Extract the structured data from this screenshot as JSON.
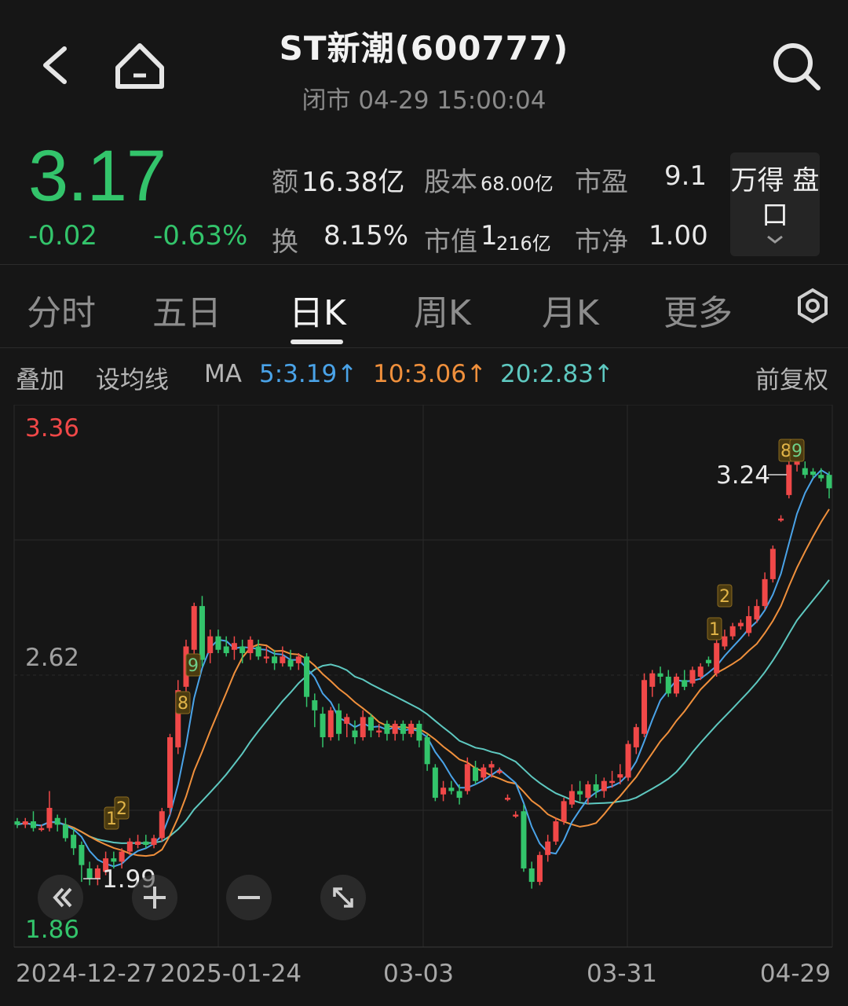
{
  "header": {
    "title": "ST新潮(600777)",
    "status": "闭市 04-29 15:00:04"
  },
  "quote": {
    "price": "3.17",
    "change": "-0.02",
    "change_pct": "-0.63%",
    "amount_label": "额",
    "amount": "16.38亿",
    "capital_label": "股本",
    "capital": "68.00亿",
    "pe_label": "市盈",
    "pe": "9.1",
    "turnover_label": "换",
    "turnover": "8.15%",
    "mktcap_label": "市值",
    "mktcap_a": "1",
    "mktcap_b": "216亿",
    "pb_label": "市净",
    "pb": "1.00",
    "panel_button": "万得 盘口"
  },
  "tabs": [
    {
      "label": "分时"
    },
    {
      "label": "五日"
    },
    {
      "label": "日K",
      "active": true
    },
    {
      "label": "周K"
    },
    {
      "label": "月K"
    },
    {
      "label": "更多"
    }
  ],
  "ma_row": {
    "overlay": "叠加",
    "set_ma": "设均线",
    "ma": "MA",
    "ma5": "5:3.19↑",
    "ma10": "10:3.06↑",
    "ma20": "20:2.83↑",
    "adjust": "前复权"
  },
  "colors": {
    "up": "#f04848",
    "down": "#33c46b",
    "ma5": "#4aa3e8",
    "ma10": "#f0903c",
    "ma20": "#5ec8c0"
  },
  "chart_data": {
    "type": "candlestick",
    "y_labels": [
      "3.36",
      "2.62",
      "1.86"
    ],
    "ylim": [
      1.86,
      3.36
    ],
    "x_labels": [
      "2024-12-27",
      "2025-01-24",
      "03-03",
      "03-31",
      "04-29"
    ],
    "high_marker": "3.24",
    "low_marker": "1.99",
    "signal_badges": [
      "1",
      "2",
      "8",
      "9",
      "1",
      "2",
      "8",
      "9"
    ],
    "candles": [
      [
        2.18,
        2.17,
        2.19,
        2.16
      ],
      [
        2.17,
        2.18,
        2.19,
        2.16
      ],
      [
        2.18,
        2.16,
        2.21,
        2.15
      ],
      [
        2.16,
        2.16,
        2.17,
        2.15
      ],
      [
        2.16,
        2.22,
        2.27,
        2.15
      ],
      [
        2.19,
        2.17,
        2.2,
        2.15
      ],
      [
        2.17,
        2.13,
        2.19,
        2.12
      ],
      [
        2.14,
        2.1,
        2.16,
        2.08
      ],
      [
        2.11,
        2.05,
        2.12,
        2.0
      ],
      [
        2.04,
        2.01,
        2.06,
        1.99
      ],
      [
        2.01,
        2.04,
        2.05,
        1.99
      ],
      [
        2.03,
        2.07,
        2.09,
        2.02
      ],
      [
        2.07,
        2.06,
        2.09,
        2.04
      ],
      [
        2.06,
        2.09,
        2.1,
        2.04
      ],
      [
        2.09,
        2.12,
        2.13,
        2.08
      ],
      [
        2.11,
        2.12,
        2.14,
        2.1
      ],
      [
        2.12,
        2.11,
        2.14,
        2.1
      ],
      [
        2.11,
        2.13,
        2.14,
        2.1
      ],
      [
        2.13,
        2.21,
        2.22,
        2.12
      ],
      [
        2.22,
        2.43,
        2.44,
        2.2
      ],
      [
        2.4,
        2.57,
        2.6,
        2.38
      ],
      [
        2.58,
        2.7,
        2.72,
        2.55
      ],
      [
        2.69,
        2.82,
        2.83,
        2.66
      ],
      [
        2.82,
        2.66,
        2.85,
        2.64
      ],
      [
        2.68,
        2.73,
        2.75,
        2.65
      ],
      [
        2.73,
        2.69,
        2.75,
        2.68
      ],
      [
        2.7,
        2.68,
        2.73,
        2.67
      ],
      [
        2.69,
        2.71,
        2.73,
        2.66
      ],
      [
        2.7,
        2.68,
        2.72,
        2.65
      ],
      [
        2.68,
        2.72,
        2.73,
        2.66
      ],
      [
        2.7,
        2.67,
        2.72,
        2.66
      ],
      [
        2.67,
        2.67,
        2.7,
        2.65
      ],
      [
        2.67,
        2.65,
        2.69,
        2.63
      ],
      [
        2.65,
        2.67,
        2.7,
        2.64
      ],
      [
        2.66,
        2.64,
        2.69,
        2.63
      ],
      [
        2.65,
        2.67,
        2.68,
        2.63
      ],
      [
        2.67,
        2.55,
        2.68,
        2.52
      ],
      [
        2.54,
        2.51,
        2.56,
        2.46
      ],
      [
        2.5,
        2.43,
        2.52,
        2.4
      ],
      [
        2.43,
        2.51,
        2.52,
        2.42
      ],
      [
        2.51,
        2.44,
        2.53,
        2.42
      ],
      [
        2.47,
        2.49,
        2.5,
        2.43
      ],
      [
        2.45,
        2.43,
        2.48,
        2.41
      ],
      [
        2.43,
        2.49,
        2.51,
        2.42
      ],
      [
        2.49,
        2.45,
        2.5,
        2.43
      ],
      [
        2.45,
        2.45,
        2.47,
        2.43
      ],
      [
        2.47,
        2.44,
        2.48,
        2.42
      ],
      [
        2.44,
        2.47,
        2.48,
        2.42
      ],
      [
        2.47,
        2.44,
        2.48,
        2.42
      ],
      [
        2.44,
        2.47,
        2.48,
        2.43
      ],
      [
        2.47,
        2.42,
        2.48,
        2.4
      ],
      [
        2.43,
        2.35,
        2.44,
        2.33
      ],
      [
        2.34,
        2.25,
        2.35,
        2.24
      ],
      [
        2.26,
        2.28,
        2.3,
        2.24
      ],
      [
        2.28,
        2.27,
        2.3,
        2.26
      ],
      [
        2.27,
        2.25,
        2.29,
        2.23
      ],
      [
        2.27,
        2.35,
        2.37,
        2.26
      ],
      [
        2.34,
        2.3,
        2.36,
        2.29
      ],
      [
        2.31,
        2.34,
        2.35,
        2.3
      ],
      [
        2.34,
        2.35,
        2.36,
        2.31
      ],
      [
        2.33,
        2.33,
        2.34,
        2.32
      ],
      [
        2.25,
        2.25,
        2.26,
        2.24
      ],
      [
        2.2,
        2.2,
        2.21,
        2.19
      ],
      [
        2.21,
        2.04,
        2.23,
        2.03
      ],
      [
        2.04,
        2.0,
        2.06,
        1.98
      ],
      [
        2.0,
        2.08,
        2.09,
        1.99
      ],
      [
        2.08,
        2.12,
        2.14,
        2.06
      ],
      [
        2.12,
        2.18,
        2.19,
        2.11
      ],
      [
        2.18,
        2.24,
        2.25,
        2.17
      ],
      [
        2.23,
        2.27,
        2.29,
        2.22
      ],
      [
        2.27,
        2.26,
        2.3,
        2.24
      ],
      [
        2.25,
        2.29,
        2.3,
        2.23
      ],
      [
        2.29,
        2.27,
        2.32,
        2.25
      ],
      [
        2.27,
        2.3,
        2.31,
        2.25
      ],
      [
        2.3,
        2.3,
        2.33,
        2.28
      ],
      [
        2.31,
        2.32,
        2.35,
        2.29
      ],
      [
        2.31,
        2.41,
        2.42,
        2.3
      ],
      [
        2.4,
        2.46,
        2.47,
        2.38
      ],
      [
        2.44,
        2.6,
        2.62,
        2.43
      ],
      [
        2.58,
        2.62,
        2.63,
        2.55
      ],
      [
        2.62,
        2.61,
        2.64,
        2.59
      ],
      [
        2.61,
        2.56,
        2.63,
        2.55
      ],
      [
        2.56,
        2.61,
        2.62,
        2.55
      ],
      [
        2.6,
        2.58,
        2.63,
        2.57
      ],
      [
        2.59,
        2.63,
        2.64,
        2.58
      ],
      [
        2.61,
        2.64,
        2.65,
        2.6
      ],
      [
        2.66,
        2.65,
        2.67,
        2.64
      ],
      [
        2.62,
        2.71,
        2.72,
        2.61
      ],
      [
        2.7,
        2.73,
        2.75,
        2.69
      ],
      [
        2.73,
        2.76,
        2.77,
        2.72
      ],
      [
        2.76,
        2.77,
        2.78,
        2.75
      ],
      [
        2.74,
        2.79,
        2.82,
        2.73
      ],
      [
        2.78,
        2.82,
        2.84,
        2.77
      ],
      [
        2.82,
        2.9,
        2.92,
        2.81
      ],
      [
        2.9,
        2.99,
        3.0,
        2.89
      ],
      [
        3.08,
        3.08,
        3.09,
        3.07
      ],
      [
        3.15,
        3.24,
        3.26,
        3.14
      ],
      [
        3.24,
        3.26,
        3.28,
        3.22
      ],
      [
        3.23,
        3.21,
        3.25,
        3.2
      ],
      [
        3.22,
        3.21,
        3.23,
        3.2
      ],
      [
        3.21,
        3.2,
        3.23,
        3.19
      ],
      [
        3.21,
        3.17,
        3.22,
        3.14
      ]
    ]
  }
}
